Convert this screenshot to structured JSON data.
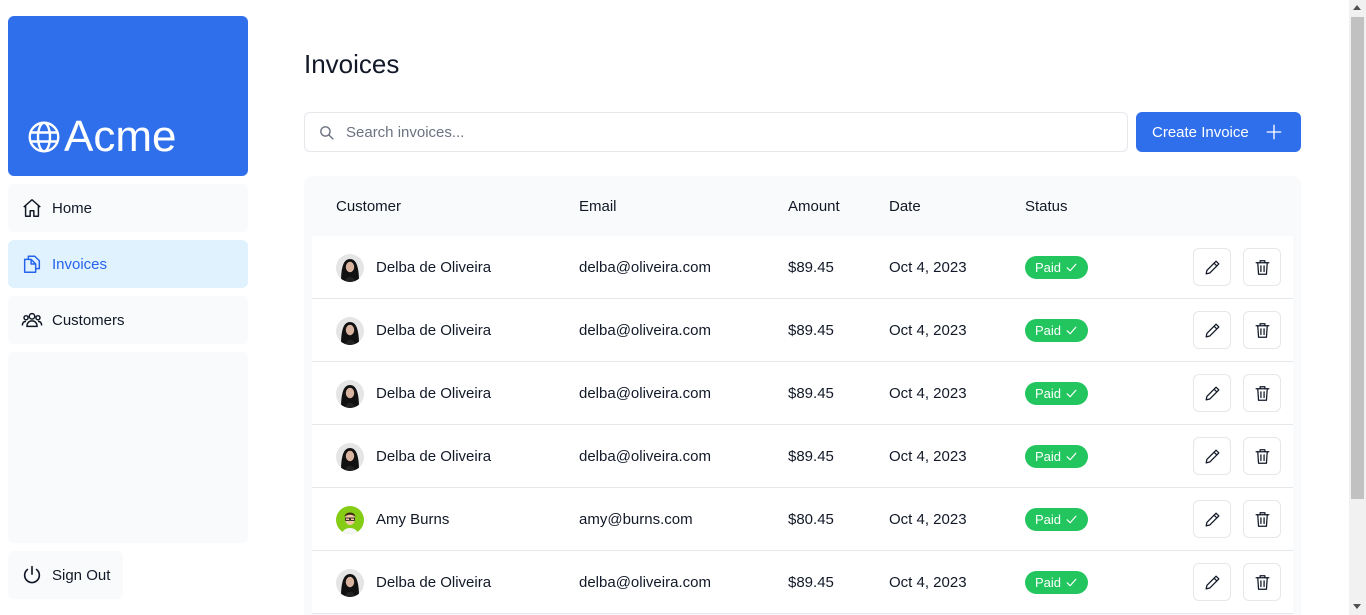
{
  "brand": {
    "name": "Acme",
    "color": "#2f6feb"
  },
  "nav": [
    {
      "label": "Home",
      "icon": "home-icon"
    },
    {
      "label": "Invoices",
      "icon": "document-duplicate-icon",
      "active": true
    },
    {
      "label": "Customers",
      "icon": "users-icon"
    }
  ],
  "sign_out": {
    "label": "Sign Out",
    "icon": "power-icon"
  },
  "main": {
    "title": "Invoices",
    "search_placeholder": "Search invoices...",
    "create_label": "Create Invoice"
  },
  "table": {
    "columns": [
      "Customer",
      "Email",
      "Amount",
      "Date",
      "Status"
    ],
    "rows": [
      {
        "name": "Delba de Oliveira",
        "email": "delba@oliveira.com",
        "amount": "$89.45",
        "date": "Oct 4, 2023",
        "status": "Paid",
        "avatar": "delba"
      },
      {
        "name": "Delba de Oliveira",
        "email": "delba@oliveira.com",
        "amount": "$89.45",
        "date": "Oct 4, 2023",
        "status": "Paid",
        "avatar": "delba"
      },
      {
        "name": "Delba de Oliveira",
        "email": "delba@oliveira.com",
        "amount": "$89.45",
        "date": "Oct 4, 2023",
        "status": "Paid",
        "avatar": "delba"
      },
      {
        "name": "Delba de Oliveira",
        "email": "delba@oliveira.com",
        "amount": "$89.45",
        "date": "Oct 4, 2023",
        "status": "Paid",
        "avatar": "delba"
      },
      {
        "name": "Amy Burns",
        "email": "amy@burns.com",
        "amount": "$80.45",
        "date": "Oct 4, 2023",
        "status": "Paid",
        "avatar": "amy"
      },
      {
        "name": "Delba de Oliveira",
        "email": "delba@oliveira.com",
        "amount": "$89.45",
        "date": "Oct 4, 2023",
        "status": "Paid",
        "avatar": "delba"
      }
    ]
  },
  "colors": {
    "paid": "#22c55e",
    "active_nav_bg": "#e0f2fe",
    "active_nav_text": "#2563eb"
  }
}
